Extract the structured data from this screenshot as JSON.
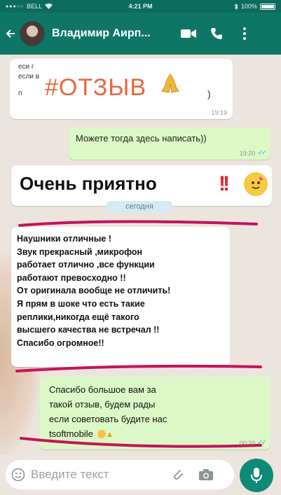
{
  "status_bar": {
    "carrier": "BELL",
    "time": "4:21 PM",
    "battery": "100%",
    "icons": [
      "signal-dots-icon",
      "wifi-icon",
      "bluetooth-icon",
      "battery-icon"
    ]
  },
  "header": {
    "contact_name": "Владимир Аирп...",
    "icons": [
      "back-arrow-icon",
      "avatar",
      "video-call-icon",
      "phone-icon",
      "more-vert-icon"
    ]
  },
  "colors": {
    "header": "#0f7667",
    "status_bar": "#0c6b5f",
    "outgoing_bubble": "#dcf8c6",
    "incoming_bubble": "#ffffff",
    "chat_background": "#ece5dd",
    "marker_pink": "#c4145a",
    "read_ticks": "#4fb3e8",
    "mic_button": "#0e8a78"
  },
  "messages": [
    {
      "direction": "in",
      "fragments": [
        "еси г",
        "если в",
        "п"
      ],
      "hashtag": "#ОТЗЫВ",
      "emoji": "folded-hands-icon",
      "trailing": ")",
      "time": "19:19"
    },
    {
      "direction": "out",
      "text": "Можете тогда здесь написать))",
      "time": "19:20",
      "read": true
    },
    {
      "direction": "in",
      "text": "Очень приятно",
      "emphasis": "!!",
      "emoji": "party-face-icon"
    },
    {
      "direction": "in",
      "lines": [
        "Наушники отличные !",
        "Звук прекрасный ,микрофон",
        "работает отлично ,все функции",
        "работают превосходно !!",
        "От оригинала вообще не отличить!",
        "Я прям в шоке что есть такие",
        "реплики,никогда ещё такого",
        "высшего качества не встречал !!",
        "Спасибо огромное!!"
      ]
    },
    {
      "direction": "out",
      "lines": [
        "Спасибо большое вам за",
        "такой отзыв, будем рады",
        "если советовать будите нас",
        "tsoftmobile"
      ],
      "time": "00:20",
      "read": true
    }
  ],
  "date_separator": "сегодня",
  "input": {
    "placeholder": "Введите текст",
    "value": ""
  }
}
